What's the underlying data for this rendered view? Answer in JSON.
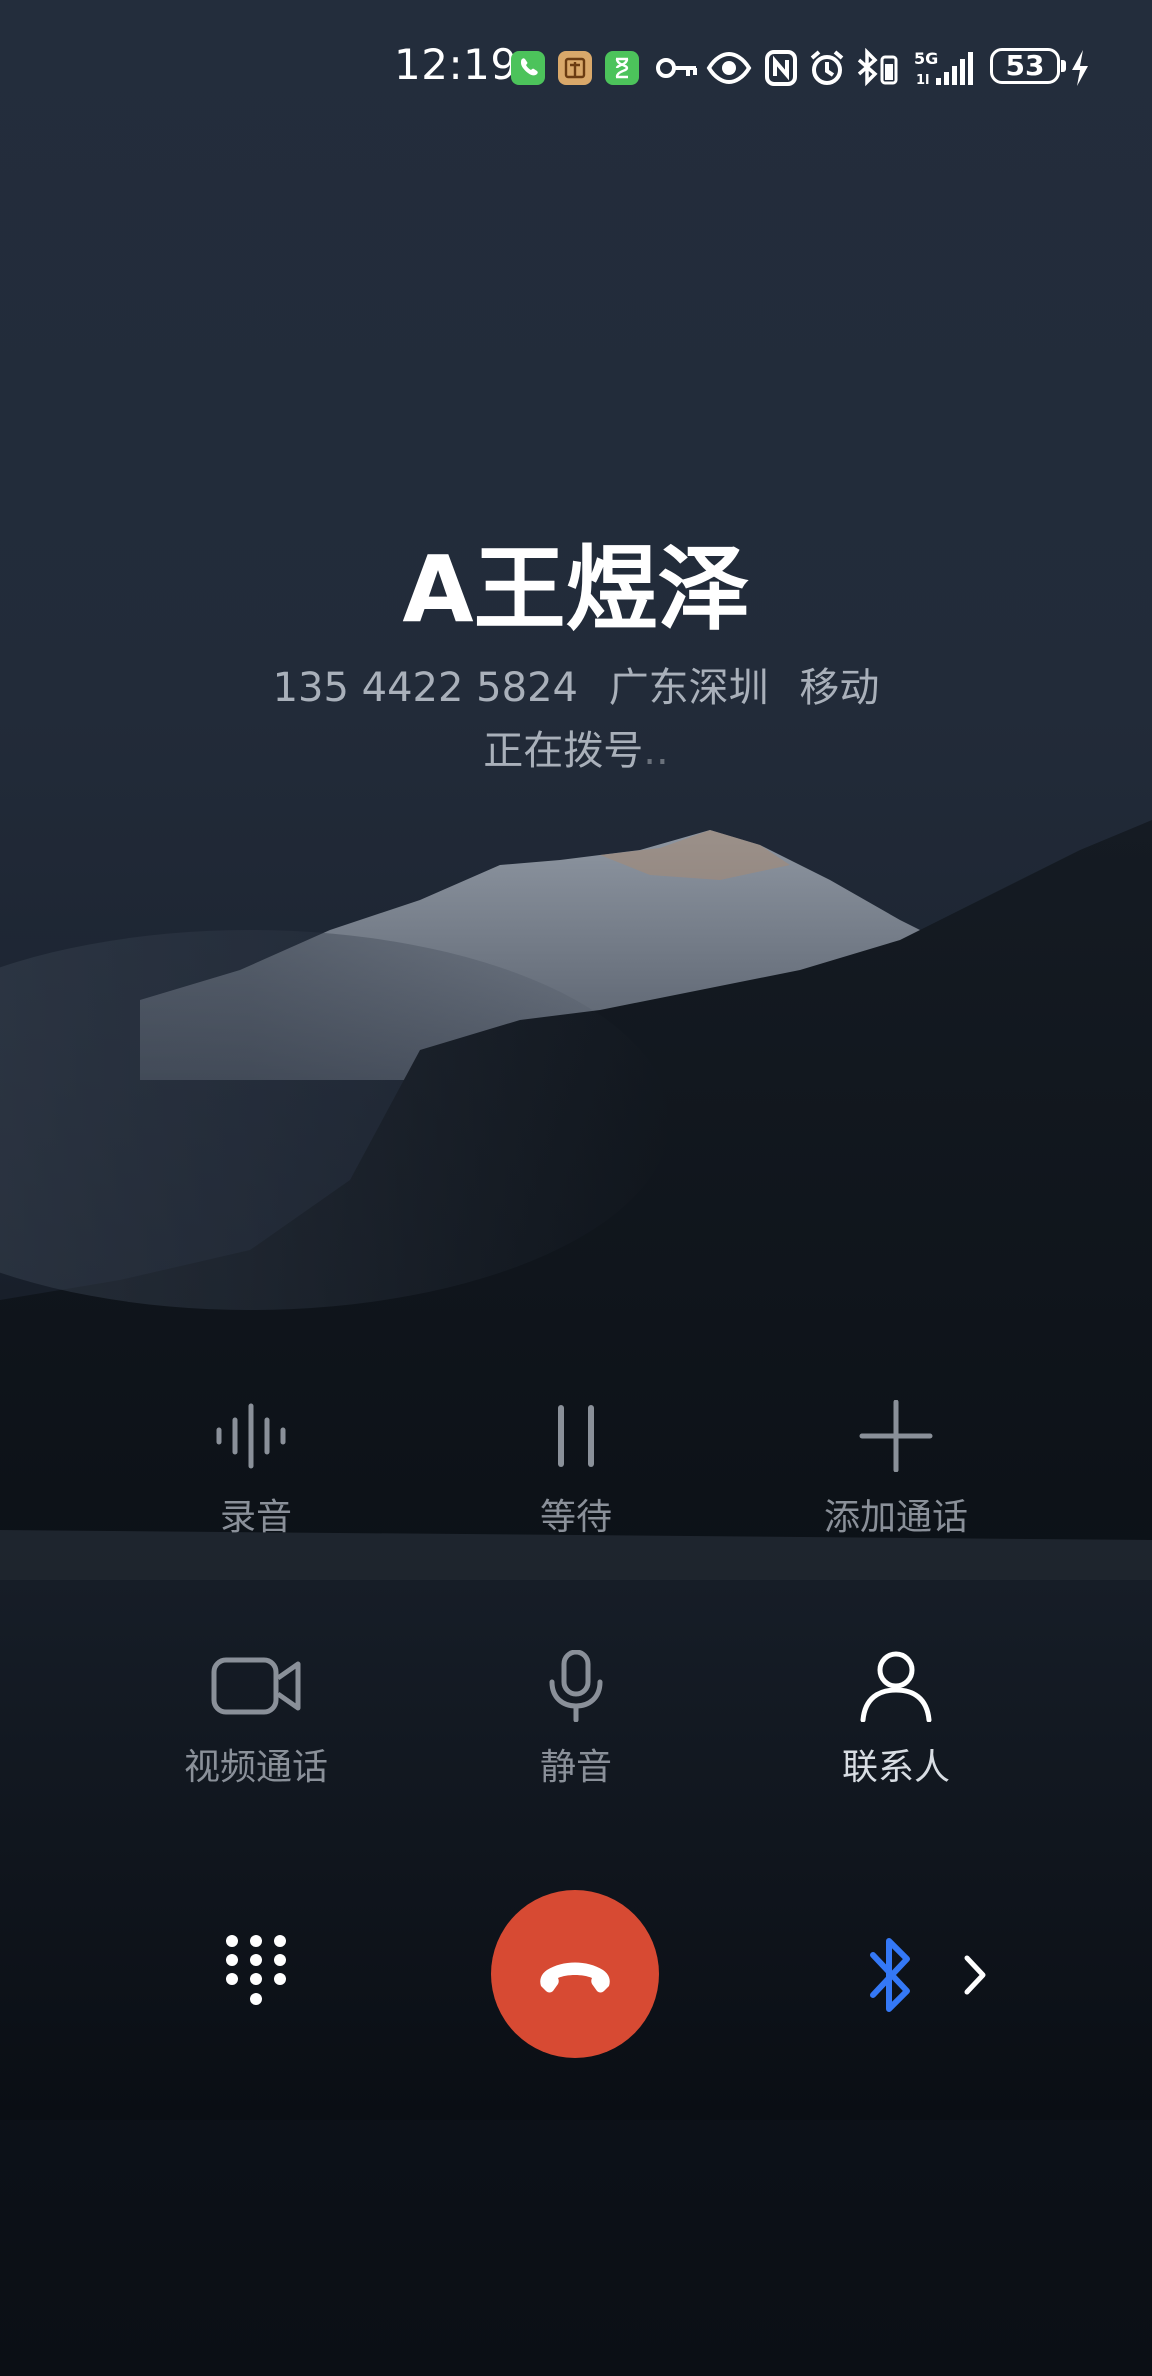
{
  "status_bar": {
    "time": "12:19",
    "battery": "53",
    "icons": [
      "phone-app-icon",
      "translate-app-icon",
      "hourglass-app-icon",
      "key-icon",
      "eye-icon",
      "nfc-icon",
      "alarm-icon",
      "bluetooth-battery-icon",
      "signal-5g-icon",
      "battery-icon",
      "charging-icon"
    ]
  },
  "caller": {
    "name": "A王煜泽",
    "number": "135 4422 5824",
    "location": "广东深圳",
    "carrier": "移动",
    "status": "正在拨号",
    "status_dots": ".."
  },
  "controls": {
    "row1": [
      {
        "label": "录音",
        "icon": "waveform-icon"
      },
      {
        "label": "等待",
        "icon": "pause-icon"
      },
      {
        "label": "添加通话",
        "icon": "plus-icon"
      }
    ],
    "row2": [
      {
        "label": "视频通话",
        "icon": "video-camera-icon"
      },
      {
        "label": "静音",
        "icon": "microphone-icon"
      },
      {
        "label": "联系人",
        "icon": "person-icon"
      }
    ]
  },
  "bottom_bar": {
    "left_icon": "dialpad-icon",
    "center_icon": "end-call-icon",
    "right_icon": "bluetooth-icon",
    "right_chevron": "chevron-right-icon"
  },
  "colors": {
    "end_call": "#d74a33",
    "bluetooth": "#3478f6",
    "background_top": "#232d3c",
    "background_bottom": "#0b0f15"
  }
}
